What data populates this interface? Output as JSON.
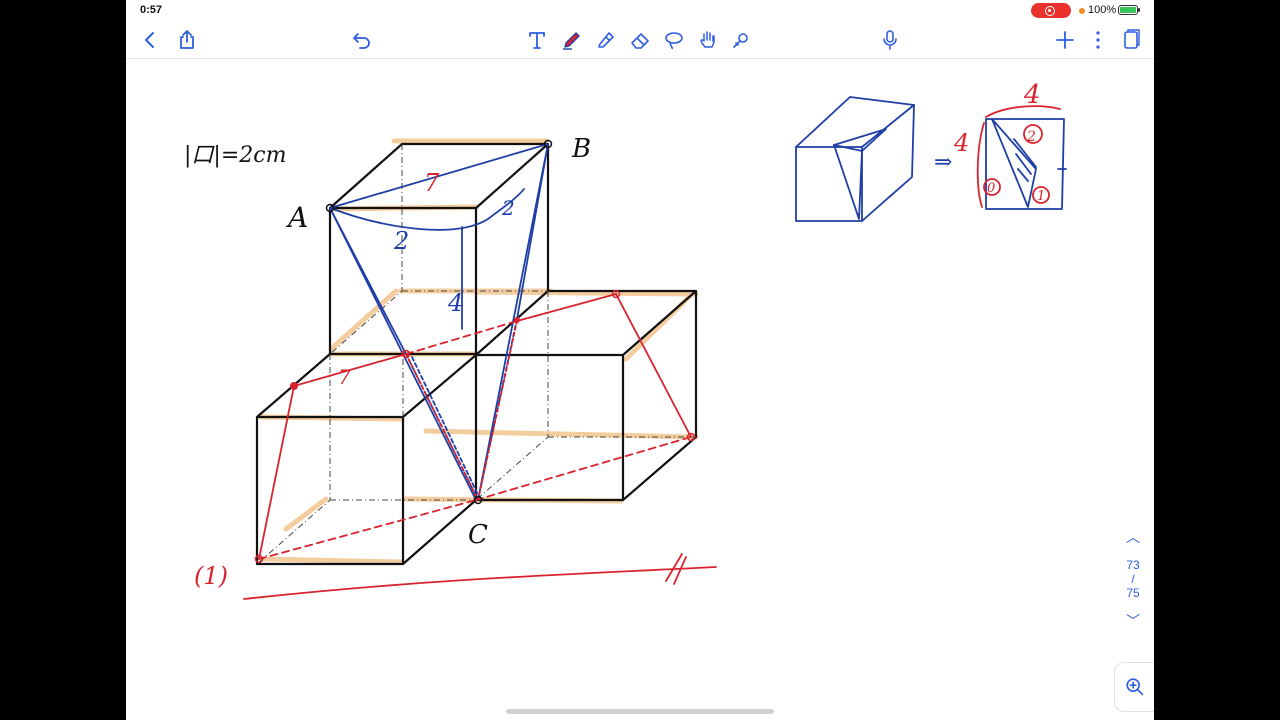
{
  "status_bar": {
    "time": "0:57",
    "battery": "100%",
    "recording": true
  },
  "toolbar": {
    "left": [
      {
        "icon": "chevron-left-icon",
        "name": "back-button"
      },
      {
        "icon": "share-icon",
        "name": "share-button"
      },
      {
        "icon": "undo-icon",
        "name": "undo-button"
      }
    ],
    "center": [
      {
        "icon": "text-tool-icon",
        "name": "text-tool"
      },
      {
        "icon": "pen-tool-icon",
        "name": "pen-tool",
        "active": true
      },
      {
        "icon": "highlighter-icon",
        "name": "highlighter-tool"
      },
      {
        "icon": "eraser-icon",
        "name": "eraser-tool"
      },
      {
        "icon": "lasso-icon",
        "name": "lasso-tool"
      },
      {
        "icon": "hand-icon",
        "name": "hand-tool"
      },
      {
        "icon": "laser-pointer-icon",
        "name": "laser-pointer-tool"
      }
    ],
    "right": [
      {
        "icon": "microphone-icon",
        "name": "record-audio-button"
      },
      {
        "icon": "plus-icon",
        "name": "add-page-button"
      },
      {
        "icon": "more-icon",
        "name": "more-button"
      },
      {
        "icon": "pages-icon",
        "name": "pages-button"
      }
    ]
  },
  "canvas": {
    "labels": {
      "edge": "|口|=2cm",
      "point_a": "A",
      "point_b": "B",
      "point_c": "C",
      "seven_top": "7",
      "seven_mid": "7",
      "two_left": "2",
      "two_right": "2",
      "four_center": "4",
      "part_number": "(1)",
      "four_right_top": "4",
      "four_right_side": "4",
      "circle_2": "2",
      "circle_0": "0",
      "circle_1": "1",
      "arrow": "⇒"
    },
    "colors": {
      "black": "#111111",
      "blue": "#1f3fa6",
      "red": "#d9232e",
      "highlight": "#f2c894",
      "accent": "#2f5fe0"
    }
  },
  "page_nav": {
    "current": "73",
    "separator": "/",
    "total": "75"
  }
}
